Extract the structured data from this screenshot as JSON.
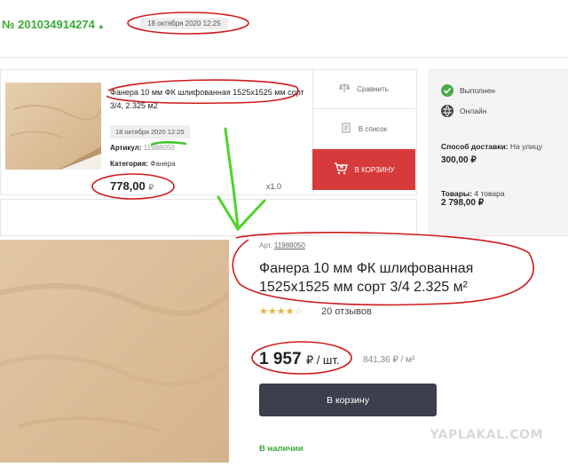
{
  "order": {
    "number": "№ 201034914274",
    "date": "18 октября 2020 12:25"
  },
  "item": {
    "name": "Фанера 10 мм ФК шлифованная 1525x1525 мм сорт 3/4, 2.325 м2",
    "date": "18 октября 2020 12:25",
    "article_label": "Артикул:",
    "article": "11988050",
    "category_label": "Категория:",
    "category": "Фанера",
    "price": "778,00",
    "currency": "₽",
    "qty": "x1.0"
  },
  "actions": {
    "compare": "Сравнить",
    "wishlist": "В список",
    "cart": "В КОРЗИНУ"
  },
  "status": {
    "done": "Выполнен",
    "online": "Онлайн",
    "delivery_label": "Способ доставки:",
    "delivery_value": "На улицу",
    "delivery_price": "300,00 ₽",
    "goods_label": "Товары:",
    "goods_value": "4 товара",
    "goods_sum": "2 798,00 ₽"
  },
  "product": {
    "article_label": "Арт.",
    "article": "11988050",
    "title": "Фанера 10 мм ФК шлифованная 1525x1525 мм сорт 3/4 2.325 м²",
    "rating": 3.5,
    "reviews": "20 отзывов",
    "price": "1 957",
    "unit": "₽ / шт.",
    "price_per_m": "841,36 ₽ / м²",
    "buy": "В корзину",
    "stock": "В наличии"
  },
  "watermark": "YAPLAKAL.COM",
  "colors": {
    "green": "#3aaa35",
    "red_button": "#d73a3a",
    "dark_button": "#3c3f4c",
    "annotation_red": "#d01a1a",
    "annotation_green": "#4cd42a"
  }
}
